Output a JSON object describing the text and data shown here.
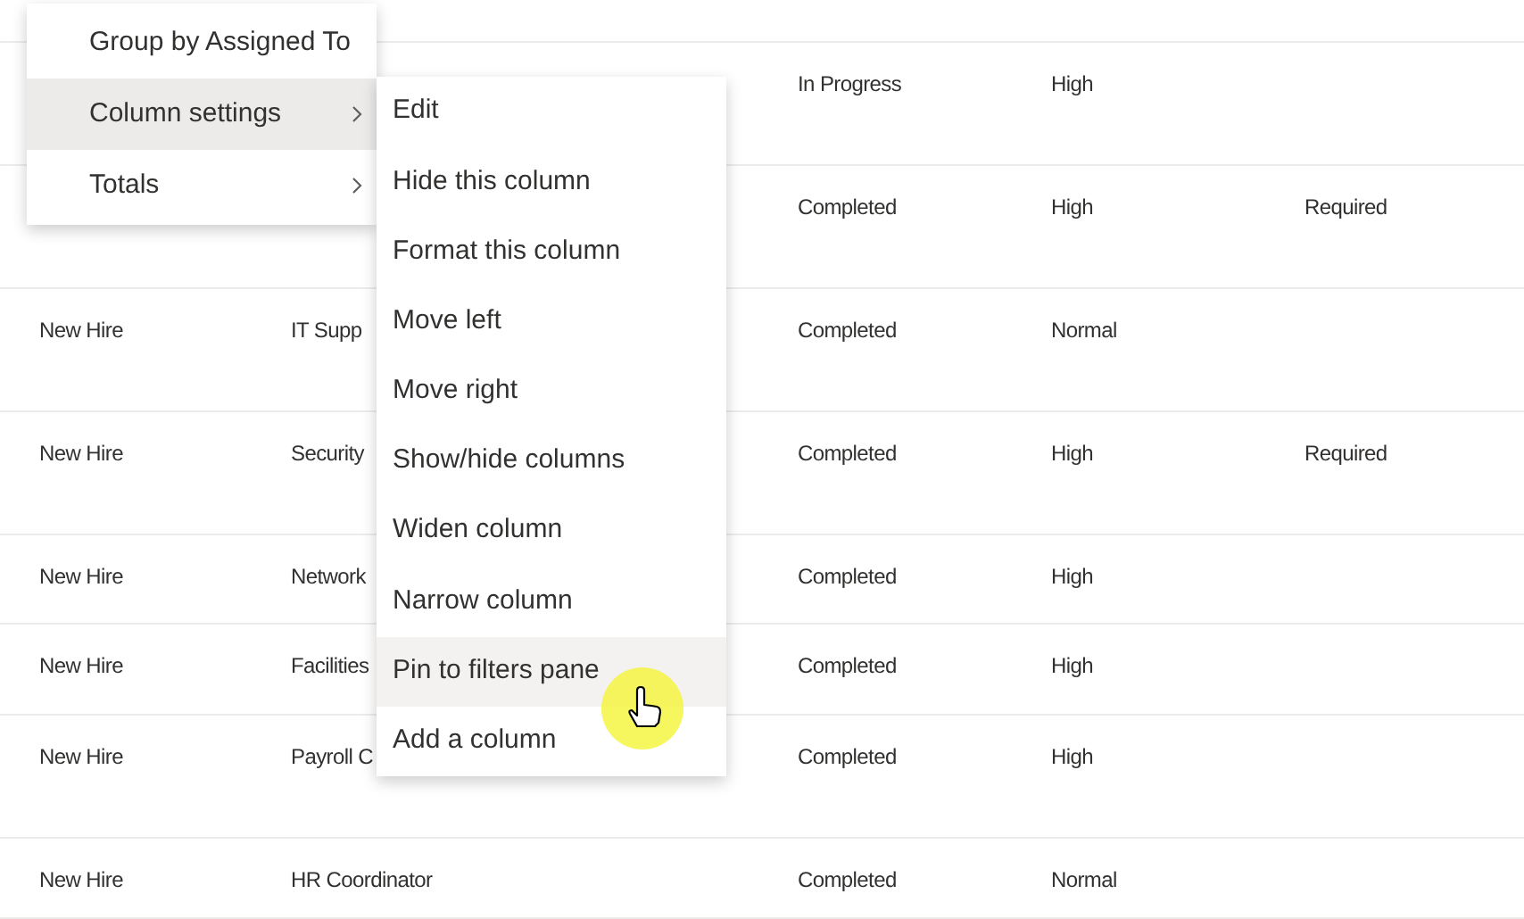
{
  "table": {
    "rows": [
      {
        "column_3": "In Progress",
        "column_4": "High"
      },
      {
        "column_3": "Completed",
        "column_4": "High",
        "column_5": "Required"
      },
      {
        "column_1": "New Hire",
        "column_2": "IT Supp",
        "column_3": "Completed",
        "column_4": "Normal"
      },
      {
        "column_1": "New Hire",
        "column_2": "Security",
        "column_3": "Completed",
        "column_4": "High",
        "column_5": "Required"
      },
      {
        "column_1": "New Hire",
        "column_2": "Network",
        "column_3": "Completed",
        "column_4": "High"
      },
      {
        "column_1": "New Hire",
        "column_2": "Facilities",
        "column_3": "Completed",
        "column_4": "High"
      },
      {
        "column_1": "New Hire",
        "column_2": "Payroll C",
        "column_3": "Completed",
        "column_4": "High"
      },
      {
        "column_1": "New Hire",
        "column_2": "HR Coordinator",
        "column_3": "Completed",
        "column_4": "Normal"
      }
    ]
  },
  "column_menu": {
    "items": [
      {
        "label": "Group by Assigned To",
        "selected": false,
        "has_submenu": false
      },
      {
        "label": "Column settings",
        "selected": true,
        "has_submenu": true
      },
      {
        "label": "Totals",
        "selected": false,
        "has_submenu": true
      }
    ]
  },
  "column_settings_menu": {
    "items": [
      {
        "label": "Edit",
        "selected": false
      },
      {
        "label": "Hide this column",
        "selected": false
      },
      {
        "label": "Format this column",
        "selected": false
      },
      {
        "label": "Move left",
        "selected": false
      },
      {
        "label": "Move right",
        "selected": false
      },
      {
        "label": "Show/hide columns",
        "selected": false
      },
      {
        "label": "Widen column",
        "selected": false
      },
      {
        "label": "Narrow column",
        "selected": false
      },
      {
        "label": "Pin to filters pane",
        "selected": true
      },
      {
        "label": "Add a column",
        "selected": false
      }
    ]
  }
}
